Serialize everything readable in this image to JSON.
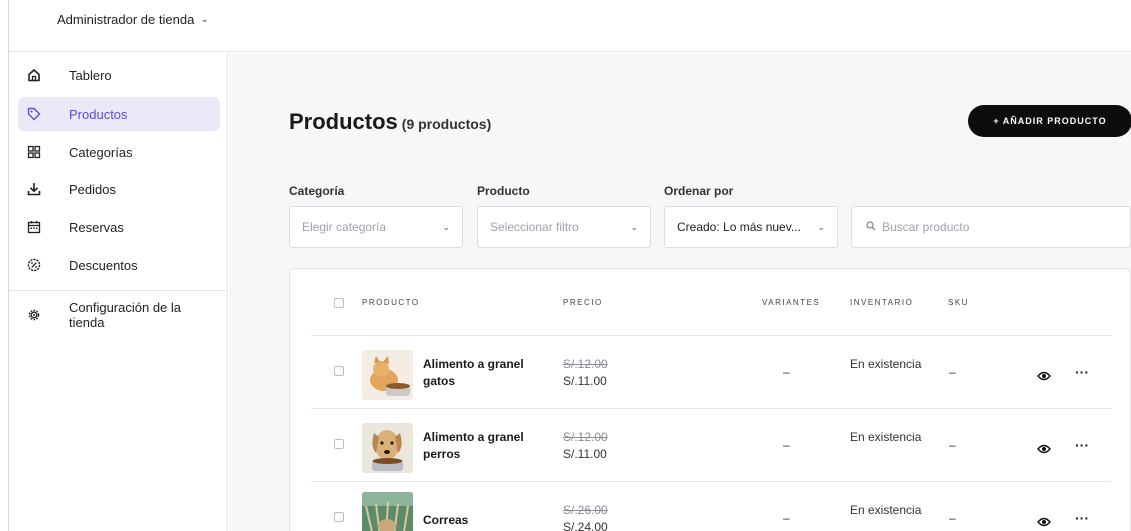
{
  "header": {
    "store_label": "Administrador de tienda"
  },
  "sidebar": {
    "items": [
      {
        "label": "Tablero",
        "icon": "home-icon"
      },
      {
        "label": "Productos",
        "icon": "tag-icon",
        "active": true
      },
      {
        "label": "Categorías",
        "icon": "grid-icon"
      },
      {
        "label": "Pedidos",
        "icon": "download-icon"
      },
      {
        "label": "Reservas",
        "icon": "calendar-icon"
      },
      {
        "label": "Descuentos",
        "icon": "discount-icon"
      }
    ],
    "settings": {
      "label": "Configuración de la tienda",
      "icon": "gear-icon"
    }
  },
  "page": {
    "title": "Productos",
    "count": "(9 productos)",
    "add_button": "+ AÑADIR PRODUCTO"
  },
  "filters": {
    "category": {
      "label": "Categoría",
      "placeholder": "Elegir categoría"
    },
    "product": {
      "label": "Producto",
      "placeholder": "Seleccionar filtro"
    },
    "sort": {
      "label": "Ordenar por",
      "value": "Creado: Lo más nuev..."
    },
    "search": {
      "placeholder": "Buscar producto"
    }
  },
  "table": {
    "columns": [
      "PRODUCTO",
      "PRECIO",
      "VARIANTES",
      "INVENTARIO",
      "SKU"
    ],
    "rows": [
      {
        "name": "Alimento a granel gatos",
        "old_price": "S/.12.00",
        "price": "S/.11.00",
        "variants": "–",
        "inventory": "En existencia",
        "sku": "–"
      },
      {
        "name": "Alimento a granel perros",
        "old_price": "S/.12.00",
        "price": "S/.11.00",
        "variants": "–",
        "inventory": "En existencia",
        "sku": "–"
      },
      {
        "name": "Correas",
        "old_price": "S/.26.00",
        "price": "S/.24.00",
        "variants": "–",
        "inventory": "En existencia",
        "sku": "–"
      }
    ]
  },
  "colors": {
    "accent": "#5a4fcf",
    "active_bg": "#ebe8f8",
    "button_bg": "#0d0d0d",
    "main_bg": "#f6f7f9"
  }
}
